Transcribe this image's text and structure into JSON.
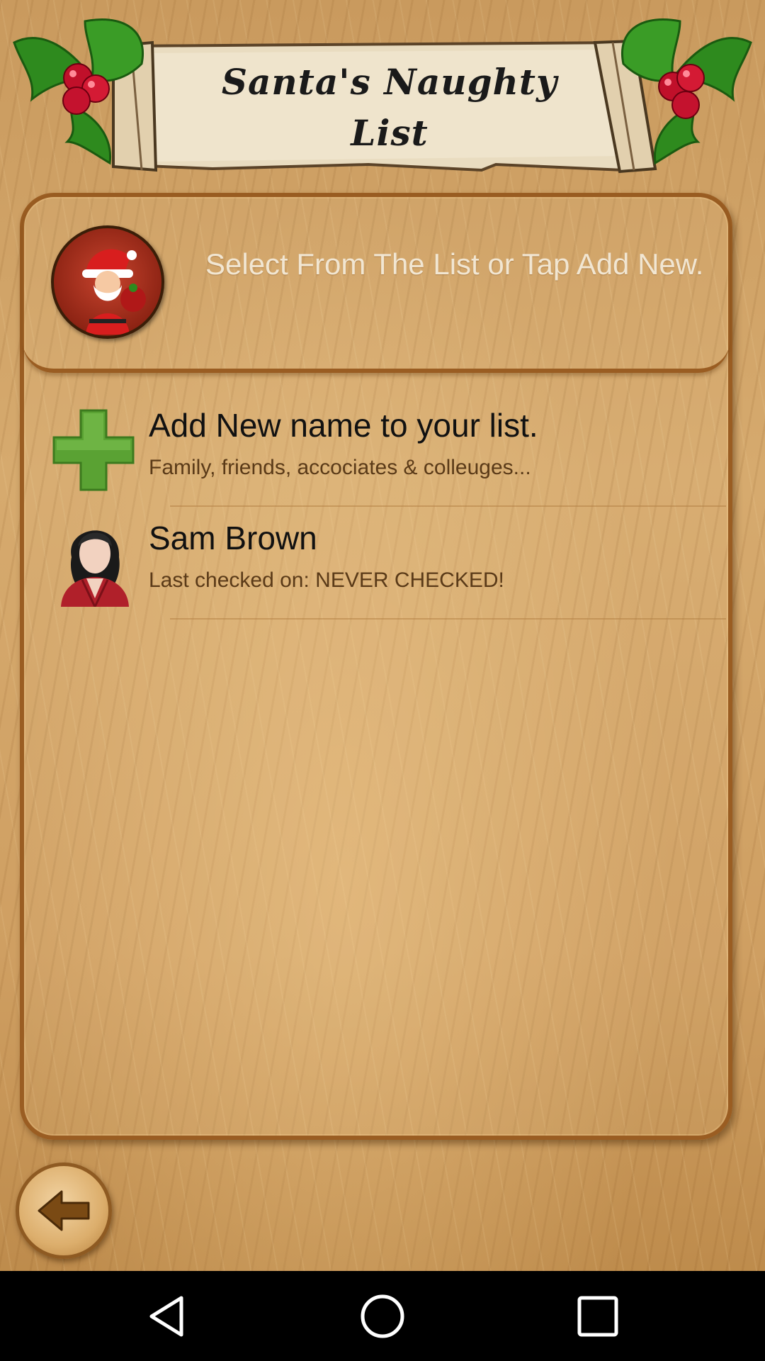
{
  "banner": {
    "title": "Santa's Naughty\nList"
  },
  "header": {
    "instruction": "Select From The List or Tap Add New."
  },
  "list": {
    "items": [
      {
        "title": "Add New name to your list.",
        "subtitle": "Family, friends, accociates & colleuges...",
        "icon": "plus-icon"
      },
      {
        "title": "Sam Brown",
        "subtitle": "Last checked on: NEVER CHECKED!",
        "icon": "person-avatar-icon"
      }
    ]
  },
  "toolbar": {
    "back_icon": "back-arrow-icon"
  },
  "navbar": {
    "items": [
      "back-triangle-icon",
      "home-circle-icon",
      "recents-square-icon"
    ]
  },
  "colors": {
    "wood": "#cf9f62",
    "panel_border": "#9a5d22",
    "plus_green": "#5aa233",
    "header_text": "#f1e6d2"
  }
}
